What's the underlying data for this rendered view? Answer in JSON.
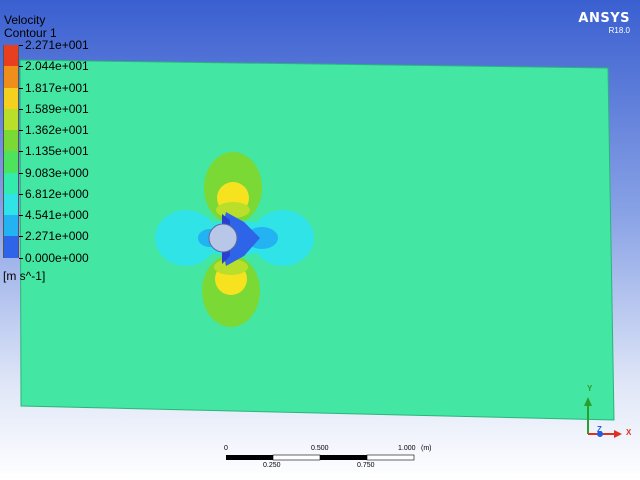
{
  "app": {
    "brand": "ANSYS",
    "version": "R18.0"
  },
  "plot": {
    "variable": "Velocity",
    "name": "Contour 1",
    "units": "[m s^-1]"
  },
  "legend": {
    "labels": [
      "2.271e+001",
      "2.044e+001",
      "1.817e+001",
      "1.589e+001",
      "1.362e+001",
      "1.135e+001",
      "9.083e+000",
      "6.812e+000",
      "4.541e+000",
      "2.271e+000",
      "0.000e+000"
    ],
    "colors": [
      "#e8401e",
      "#f08e1c",
      "#f6d01e",
      "#b9df2a",
      "#7bd936",
      "#4ee35c",
      "#33ebac",
      "#2fe3e6",
      "#23b2f2",
      "#2e64e8"
    ]
  },
  "scale": {
    "ticks_top": [
      "0",
      "0.500",
      "1.000"
    ],
    "unit": "(m)",
    "ticks_bottom": [
      "0.250",
      "0.750"
    ]
  },
  "triad": {
    "y": "Y",
    "z": "Z",
    "x": "X"
  }
}
